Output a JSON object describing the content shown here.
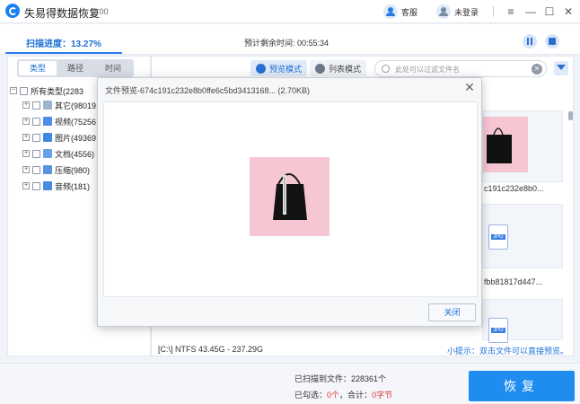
{
  "app": {
    "title": "失易得数据恢复",
    "version": "7.00",
    "support_label": "客服",
    "login_label": "未登录"
  },
  "scan": {
    "progress_label": "扫描进度：13.27%",
    "remaining_label": "预计剩余时间:",
    "remaining_time": "00:55:34"
  },
  "filter_tabs": [
    "类型",
    "路径",
    "时间"
  ],
  "tree": {
    "root": "所有类型(2283",
    "items": [
      "其它(98019",
      "视频(75256",
      "图片(49369",
      "文档(4556)",
      "压缩(980)",
      "音频(181)"
    ]
  },
  "view_modes": {
    "preview": "预览模式",
    "list": "列表模式"
  },
  "search": {
    "placeholder": "此处可以过滤文件名"
  },
  "thumbnails": {
    "label1": "c191c232e8b0...",
    "label2": "fbb81817d447..."
  },
  "status": {
    "drive_info": "[C:\\] NTFS 43.45G - 237.29G",
    "tip": "小提示：双击文件可以直接预览。"
  },
  "bottom": {
    "scanned_label": "已扫描到文件：",
    "scanned_count": "228361个",
    "selected_label": "已勾选：",
    "selected_count": "0个",
    "total_label": "合计：",
    "total_size": "0字节",
    "recover_label": "恢复"
  },
  "dialog": {
    "title": "文件预览-674c191c232e8b0ffe6c5bd3413168...   (2.70KB)",
    "close_label": "关闭"
  }
}
